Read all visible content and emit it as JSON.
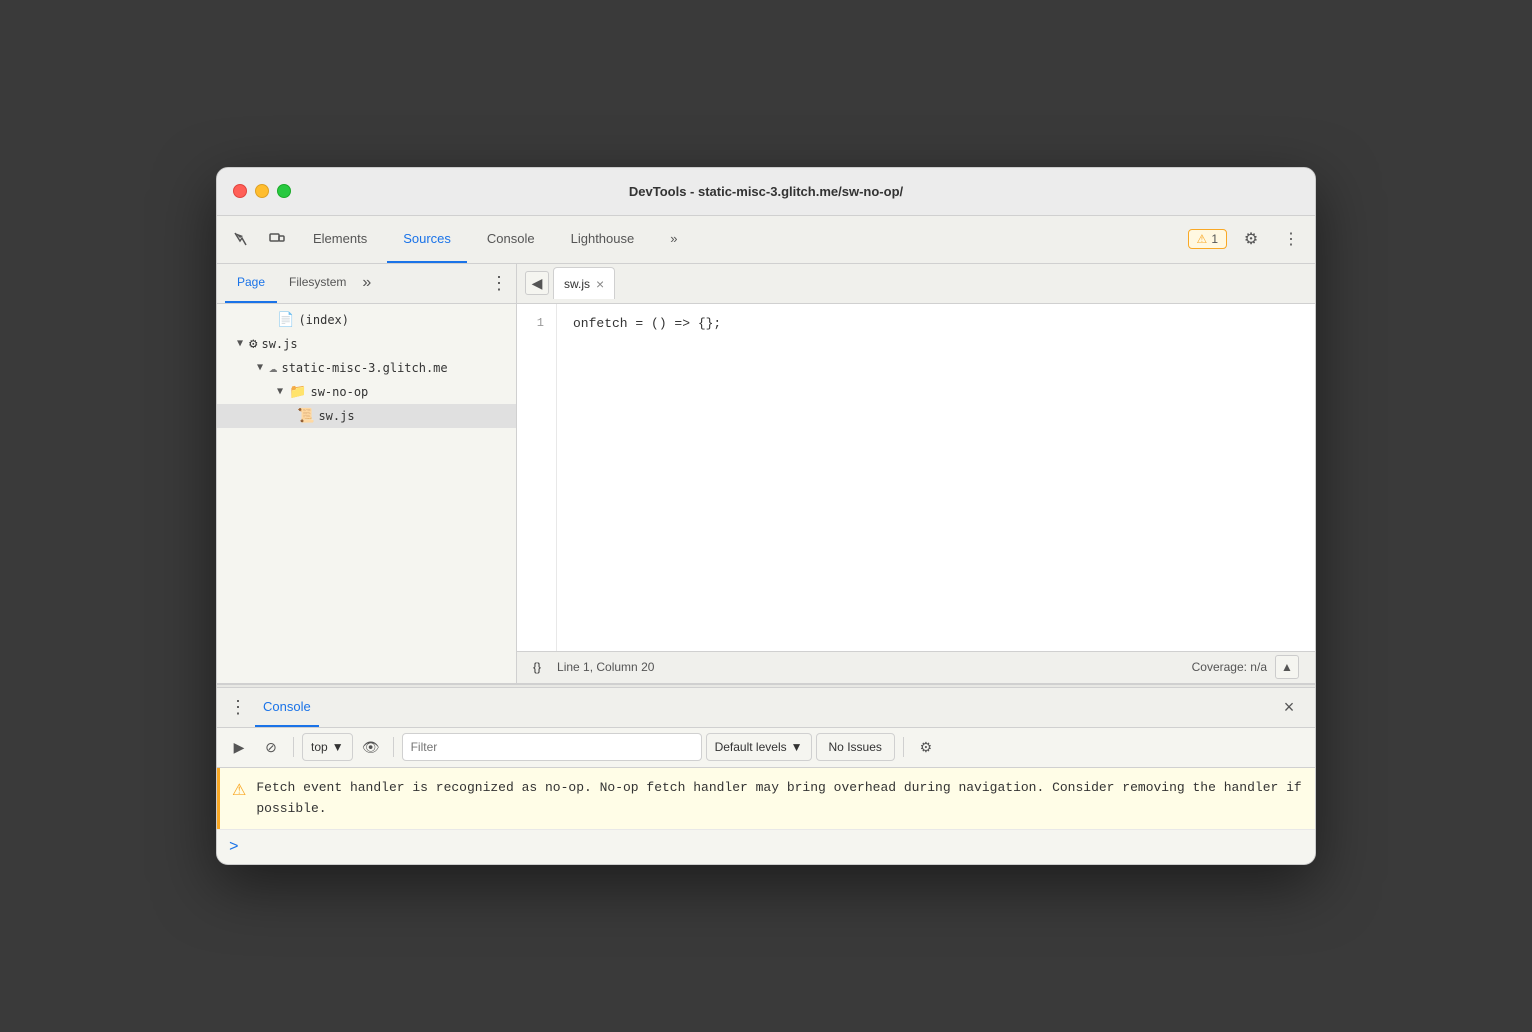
{
  "window": {
    "title": "DevTools - static-misc-3.glitch.me/sw-no-op/"
  },
  "traffic_lights": {
    "close_label": "close",
    "minimize_label": "minimize",
    "maximize_label": "maximize"
  },
  "tabs": {
    "items": [
      {
        "id": "elements",
        "label": "Elements"
      },
      {
        "id": "sources",
        "label": "Sources"
      },
      {
        "id": "console",
        "label": "Console"
      },
      {
        "id": "lighthouse",
        "label": "Lighthouse"
      }
    ],
    "active": "sources",
    "more_label": "»",
    "warning_count": "1",
    "gear_icon": "⚙",
    "more_vert_icon": "⋮"
  },
  "sources_panel": {
    "sub_tabs": {
      "items": [
        {
          "id": "page",
          "label": "Page"
        },
        {
          "id": "filesystem",
          "label": "Filesystem"
        }
      ],
      "active": "page",
      "more_label": "»",
      "menu_icon": "⋮"
    },
    "file_tree": [
      {
        "id": "index",
        "label": "(index)",
        "indent": 3,
        "type": "doc",
        "icon": "📄"
      },
      {
        "id": "sw_js_root",
        "label": "sw.js",
        "indent": 1,
        "type": "gear",
        "has_arrow": true,
        "arrow_open": true
      },
      {
        "id": "domain",
        "label": "static-misc-3.glitch.me",
        "indent": 2,
        "type": "cloud",
        "has_arrow": true,
        "arrow_open": true
      },
      {
        "id": "folder",
        "label": "sw-no-op",
        "indent": 3,
        "type": "folder",
        "has_arrow": true,
        "arrow_open": true
      },
      {
        "id": "sw_js",
        "label": "sw.js",
        "indent": 4,
        "type": "js",
        "selected": true
      }
    ]
  },
  "editor": {
    "tab_nav_icon": "◀",
    "active_file": "sw.js",
    "close_icon": "×",
    "line_numbers": [
      "1"
    ],
    "code_line1": "onfetch = () => {};",
    "status": {
      "braces_icon": "{}",
      "position": "Line 1, Column 20",
      "coverage_label": "Coverage: n/a",
      "scroll_up_icon": "▲"
    }
  },
  "console_panel": {
    "menu_icon": "⋮",
    "tab_label": "Console",
    "close_icon": "×",
    "toolbar": {
      "play_icon": "▶",
      "block_icon": "⊘",
      "top_label": "top",
      "dropdown_icon": "▼",
      "eye_icon": "👁",
      "filter_placeholder": "Filter",
      "default_levels_label": "Default levels",
      "dropdown_icon2": "▼",
      "no_issues_label": "No Issues",
      "gear_icon": "⚙"
    },
    "messages": [
      {
        "type": "warning",
        "icon": "⚠",
        "text": "Fetch event handler is recognized as no-op. No-op fetch handler may\n    bring overhead during navigation. Consider removing the handler if\n    possible."
      }
    ],
    "input": {
      "prompt": ">",
      "placeholder": ""
    }
  }
}
